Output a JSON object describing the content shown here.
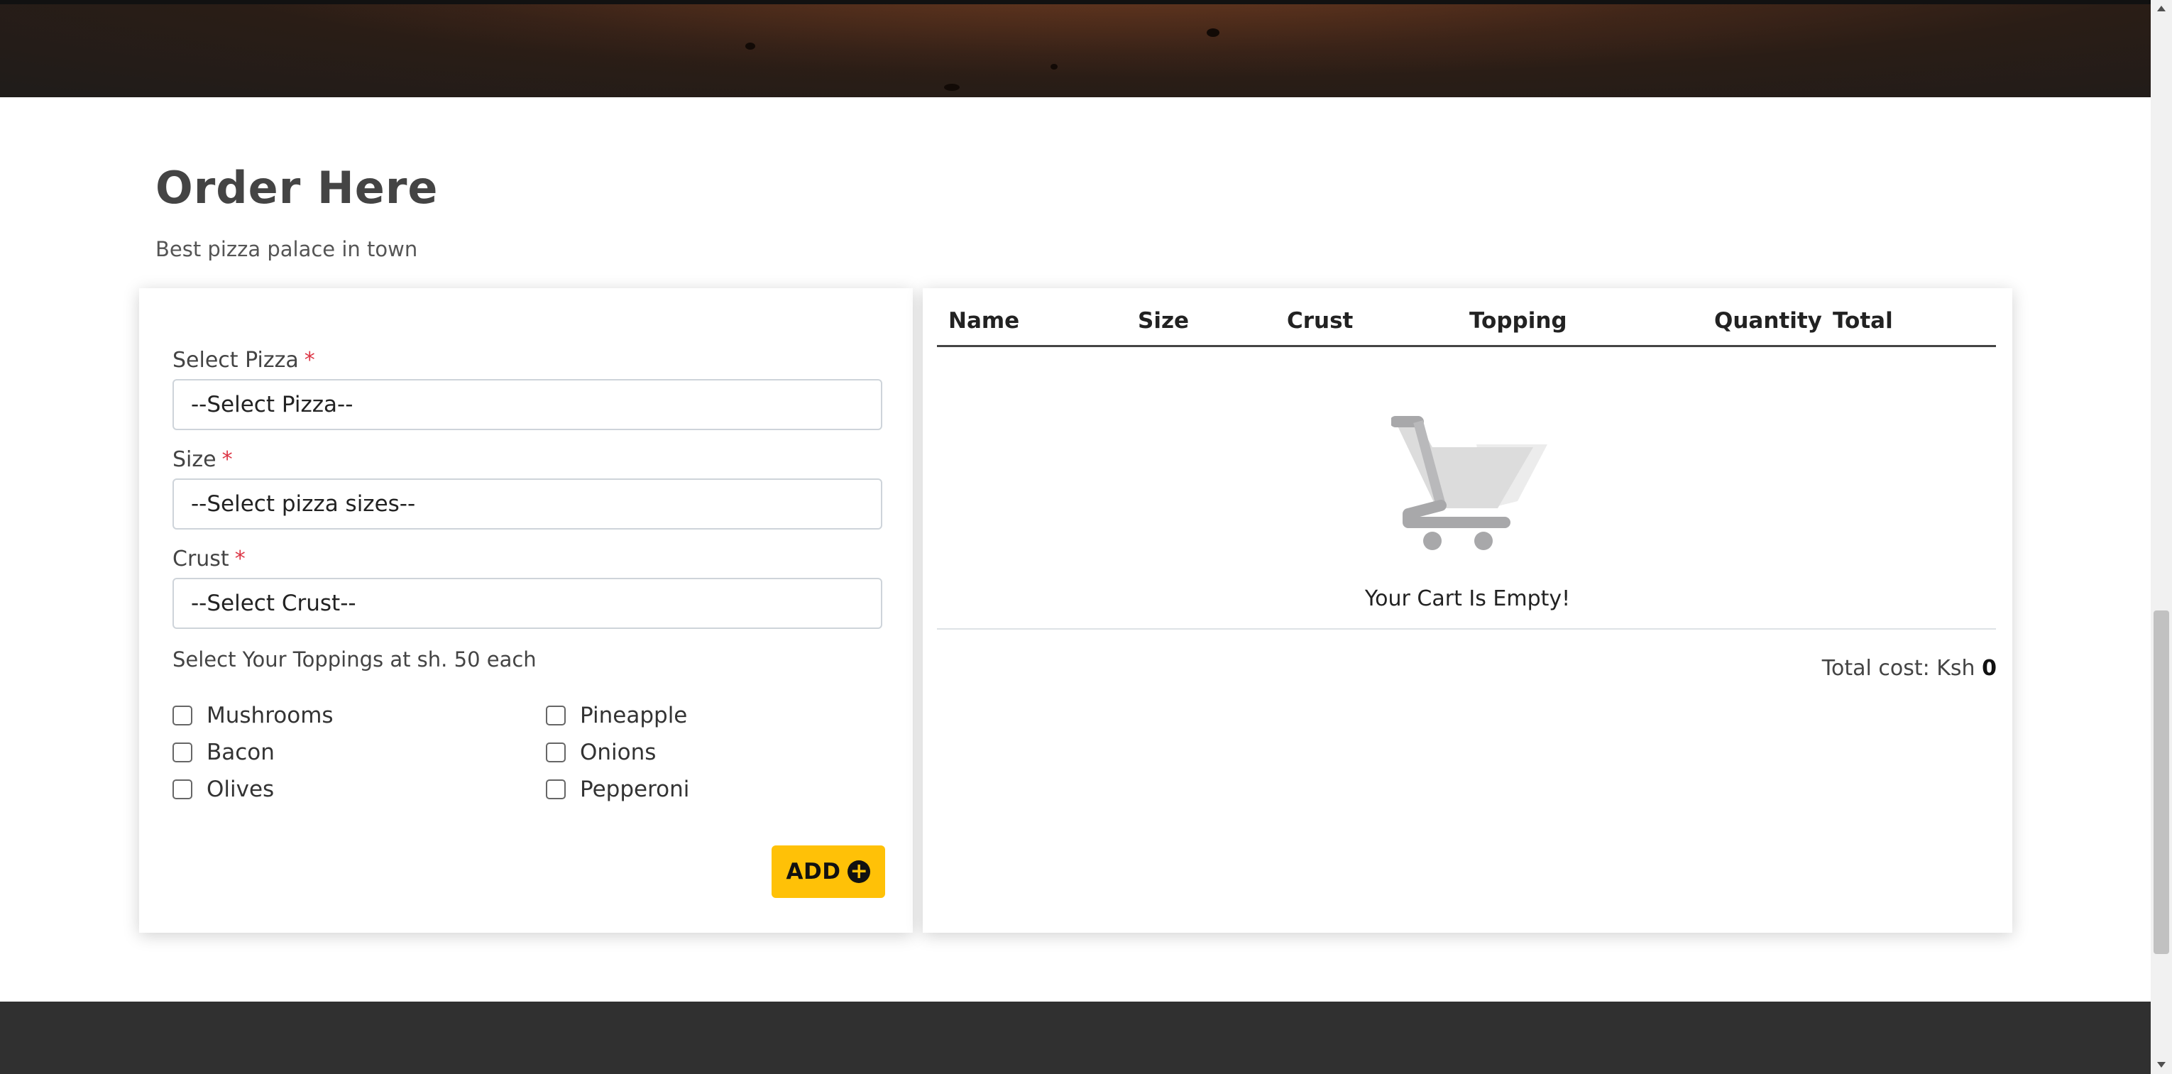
{
  "order_section": {
    "title": "Order Here",
    "subtitle": "Best pizza palace in town"
  },
  "form": {
    "pizza_label": "Select Pizza",
    "pizza_value": "--Select Pizza--",
    "size_label": "Size",
    "size_value": "--Select pizza sizes--",
    "crust_label": "Crust",
    "crust_value": "--Select Crust--",
    "required_mark": "*",
    "toppings_label": "Select Your Toppings at sh. 50 each",
    "toppings": [
      "Mushrooms",
      "Pineapple",
      "Bacon",
      "Onions",
      "Olives",
      "Pepperoni"
    ],
    "add_label": "ADD",
    "add_icon": "plus-circle-icon"
  },
  "cart": {
    "columns": [
      "Name",
      "Size",
      "Crust",
      "Topping",
      "Quantity",
      "Total"
    ],
    "empty_message": "Your Cart Is Empty!",
    "total_label": "Total cost: Ksh",
    "total_value": "0"
  },
  "colors": {
    "accent": "#ffc107",
    "required": "#dc3545",
    "footer": "#303030"
  }
}
